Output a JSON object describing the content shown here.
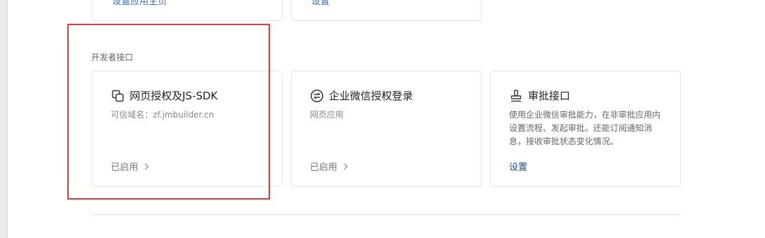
{
  "top_row": {
    "card1_link": "设置应用主页",
    "card2_link": "设置"
  },
  "developer_api": {
    "section_title": "开发者接口",
    "cards": [
      {
        "icon": "copy-layers-icon",
        "title": "网页授权及JS-SDK",
        "description": "可信域名：zf.jmbuilder.cn",
        "status": "已启用"
      },
      {
        "icon": "swap-circle-icon",
        "title": "企业微信授权登录",
        "description": "网页应用",
        "status": "已启用"
      },
      {
        "icon": "stamp-icon",
        "title": "审批接口",
        "description": "使用企业微信审批能力，在非审批应用内设置流程、发起审批。还能订阅通知消息，接收审批状态变化情况。",
        "action": "设置"
      }
    ]
  },
  "colors": {
    "highlight": "#e53935",
    "link": "#1f4b8a"
  }
}
